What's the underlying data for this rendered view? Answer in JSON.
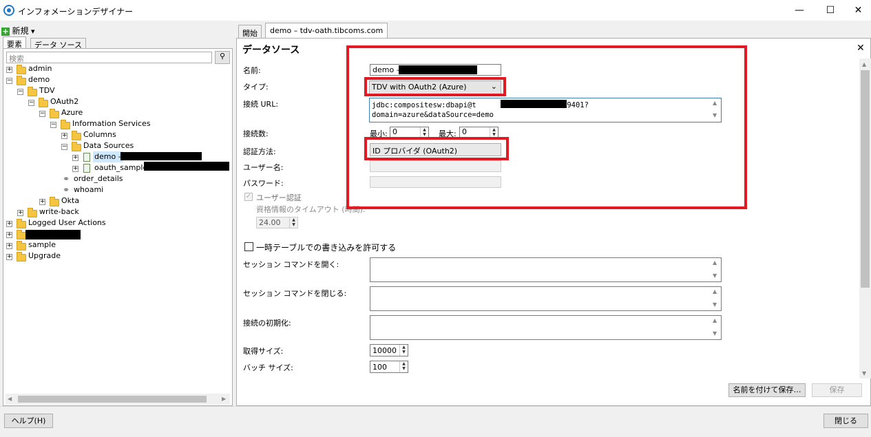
{
  "window": {
    "title": "インフォメーションデザイナー",
    "minimize": "—",
    "maximize": "☐",
    "close": "✕"
  },
  "left": {
    "new_label": "新規",
    "new_dropdown": "▾",
    "tabs": [
      "要素",
      "データ ソース"
    ],
    "search_placeholder": "検索",
    "tree": {
      "admin": "admin",
      "demo": "demo",
      "tdv": "TDV",
      "oauth2": "OAuth2",
      "azure": "Azure",
      "info_services": "Information Services",
      "columns": "Columns",
      "data_sources": "Data Sources",
      "ds_demo": "demo –",
      "ds_oauth_sample": "oauth_sample",
      "order_details": "order_details",
      "whoami": "whoami",
      "okta": "Okta",
      "write_back": "write-back",
      "logged_user_actions": "Logged User Actions",
      "sample": "sample",
      "upgrade": "Upgrade"
    }
  },
  "right": {
    "tabs": [
      "開始",
      "demo – tdv-oath.tibcoms.com"
    ],
    "heading": "データソース",
    "close_x": "✕",
    "labels": {
      "name": "名前:",
      "type": "タイプ:",
      "url": "接続 URL:",
      "connections": "接続数:",
      "min": "最小:",
      "max": "最大:",
      "auth": "認証方法:",
      "username": "ユーザー名:",
      "password": "パスワード:",
      "user_auth": "ユーザー認証",
      "credential_timeout": "資格情報のタイムアウト (時間):",
      "temp_table": "一時テーブルでの書き込みを許可する",
      "open_session": "セッション コマンドを開く:",
      "close_session": "セッション コマンドを閉じる:",
      "conn_init": "接続の初期化:",
      "fetch_size": "取得サイズ:",
      "batch_size": "バッチ サイズ:"
    },
    "values": {
      "name": "demo –",
      "type": "TDV with OAuth2 (Azure)",
      "url_line1_a": "jdbc:compositesw:dbapi@t",
      "url_line1_b": ".com:9401?",
      "url_line2": "domain=azure&dataSource=demo",
      "min": "0",
      "max": "0",
      "auth": "ID プロバイダ (OAuth2)",
      "timeout": "24.00",
      "fetch_size": "10000",
      "batch_size": "100"
    },
    "buttons": {
      "save_as": "名前を付けて保存…",
      "save": "保存"
    }
  },
  "footer": {
    "help": "ヘルプ(H)",
    "close": "閉じる"
  }
}
